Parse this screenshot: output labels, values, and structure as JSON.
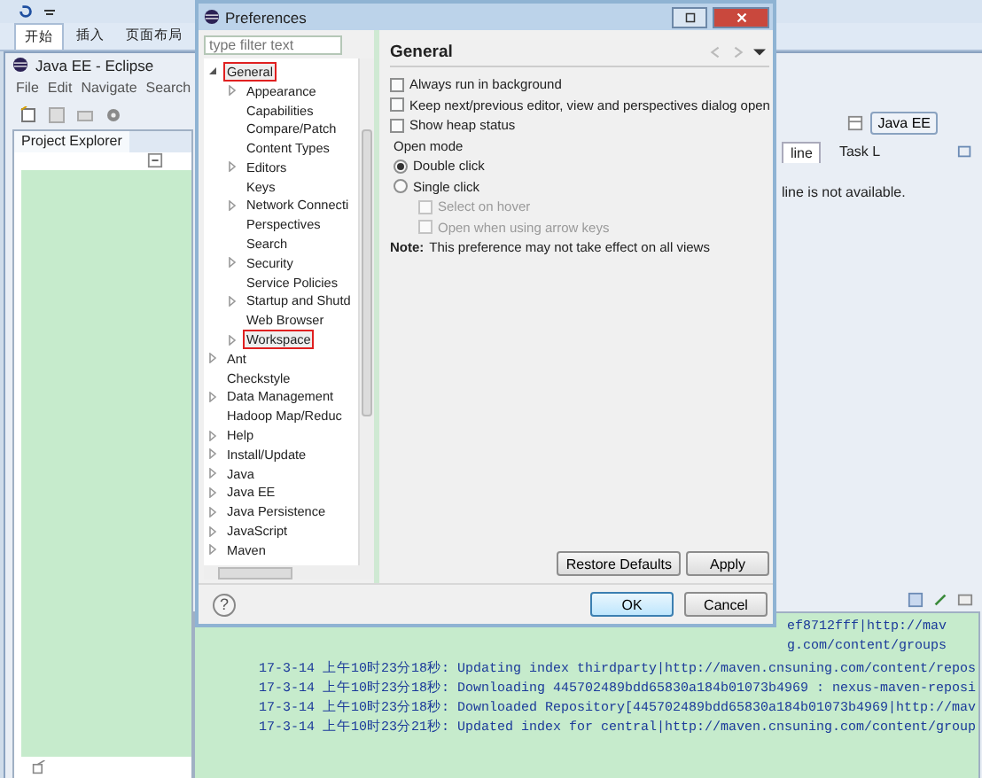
{
  "ribbon_tabs": [
    {
      "label": "开始",
      "selected": true
    },
    {
      "label": "插入",
      "selected": false
    },
    {
      "label": "页面布局",
      "selected": false
    }
  ],
  "eclipse": {
    "title": "Java EE - Eclipse",
    "menu": [
      "File",
      "Edit",
      "Navigate",
      "Search"
    ],
    "project_explorer_tab": "Project Explorer",
    "perspective": "Java EE",
    "outline_tabs": [
      {
        "label": "line",
        "selected": true
      },
      {
        "label": "Task L",
        "selected": false
      }
    ],
    "outline_message": "line is not available.",
    "console_lines": [
      {
        "kind": "tail",
        "text": "ef8712fff|http://mav"
      },
      {
        "kind": "tail",
        "text": "g.com/content/groups"
      },
      {
        "kind": "full",
        "text": "17-3-14 上午10时23分18秒: Updating index thirdparty|http://maven.cnsuning.com/content/repos"
      },
      {
        "kind": "full",
        "text": "17-3-14 上午10时23分18秒: Downloading 445702489bdd65830a184b01073b4969 : nexus-maven-reposi"
      },
      {
        "kind": "full",
        "text": "17-3-14 上午10时23分18秒: Downloaded Repository[445702489bdd65830a184b01073b4969|http://mav"
      },
      {
        "kind": "full",
        "text": "17-3-14 上午10时23分21秒: Updated index for central|http://maven.cnsuning.com/content/group"
      }
    ]
  },
  "dialog": {
    "title": "Preferences",
    "filter": {
      "placeholder": "type filter text"
    },
    "tree": [
      {
        "label": "General",
        "kind": "branch",
        "expanded": true,
        "highlighted": true,
        "children": [
          {
            "label": "Appearance",
            "kind": "branch",
            "expanded": false,
            "highlighted": false
          },
          {
            "label": "Capabilities",
            "kind": "leaf",
            "highlighted": false
          },
          {
            "label": "Compare/Patch",
            "kind": "leaf",
            "highlighted": false
          },
          {
            "label": "Content Types",
            "kind": "leaf",
            "highlighted": false
          },
          {
            "label": "Editors",
            "kind": "branch",
            "expanded": false,
            "highlighted": false
          },
          {
            "label": "Keys",
            "kind": "leaf",
            "highlighted": false
          },
          {
            "label": "Network Connecti",
            "kind": "branch",
            "expanded": false,
            "highlighted": false
          },
          {
            "label": "Perspectives",
            "kind": "leaf",
            "highlighted": false
          },
          {
            "label": "Search",
            "kind": "leaf",
            "highlighted": false
          },
          {
            "label": "Security",
            "kind": "branch",
            "expanded": false,
            "highlighted": false
          },
          {
            "label": "Service Policies",
            "kind": "leaf",
            "highlighted": false
          },
          {
            "label": "Startup and Shutd",
            "kind": "branch",
            "expanded": false,
            "highlighted": false
          },
          {
            "label": "Web Browser",
            "kind": "leaf",
            "highlighted": false
          },
          {
            "label": "Workspace",
            "kind": "branch",
            "expanded": false,
            "highlighted": true
          }
        ]
      },
      {
        "label": "Ant",
        "kind": "branch",
        "expanded": false,
        "highlighted": false
      },
      {
        "label": "Checkstyle",
        "kind": "leaf",
        "highlighted": false
      },
      {
        "label": "Data Management",
        "kind": "branch",
        "expanded": false,
        "highlighted": false
      },
      {
        "label": "Hadoop Map/Reduc",
        "kind": "leaf",
        "highlighted": false
      },
      {
        "label": "Help",
        "kind": "branch",
        "expanded": false,
        "highlighted": false
      },
      {
        "label": "Install/Update",
        "kind": "branch",
        "expanded": false,
        "highlighted": false
      },
      {
        "label": "Java",
        "kind": "branch",
        "expanded": false,
        "highlighted": false
      },
      {
        "label": "Java EE",
        "kind": "branch",
        "expanded": false,
        "highlighted": false
      },
      {
        "label": "Java Persistence",
        "kind": "branch",
        "expanded": false,
        "highlighted": false
      },
      {
        "label": "JavaScript",
        "kind": "branch",
        "expanded": false,
        "highlighted": false
      },
      {
        "label": "Maven",
        "kind": "branch",
        "expanded": false,
        "highlighted": false
      }
    ],
    "page_title": "General",
    "options": [
      {
        "kind": "checkbox",
        "label": "Always run in background",
        "checked": false,
        "disabled": false
      },
      {
        "kind": "checkbox",
        "label": "Keep next/previous editor, view and perspectives dialog open",
        "checked": false,
        "disabled": false
      },
      {
        "kind": "checkbox",
        "label": "Show heap status",
        "checked": false,
        "disabled": false
      },
      {
        "kind": "heading",
        "label": "Open mode"
      },
      {
        "kind": "radio",
        "label": "Double click",
        "selected": true,
        "disabled": false
      },
      {
        "kind": "radio",
        "label": "Single click",
        "selected": false,
        "disabled": false
      },
      {
        "kind": "sub_checkbox",
        "label": "Select on hover",
        "checked": false,
        "disabled": true
      },
      {
        "kind": "sub_checkbox",
        "label": "Open when using arrow keys",
        "checked": false,
        "disabled": true
      },
      {
        "kind": "note",
        "label": "**Note:** This preference may not take effect on all views"
      }
    ],
    "page_buttons": [
      {
        "label": "Restore Defaults",
        "default": false
      },
      {
        "label": "Apply",
        "default": false
      }
    ],
    "help_glyph": "?",
    "footer_buttons": [
      {
        "label": "OK",
        "default": true
      },
      {
        "label": "Cancel",
        "default": false
      }
    ]
  }
}
